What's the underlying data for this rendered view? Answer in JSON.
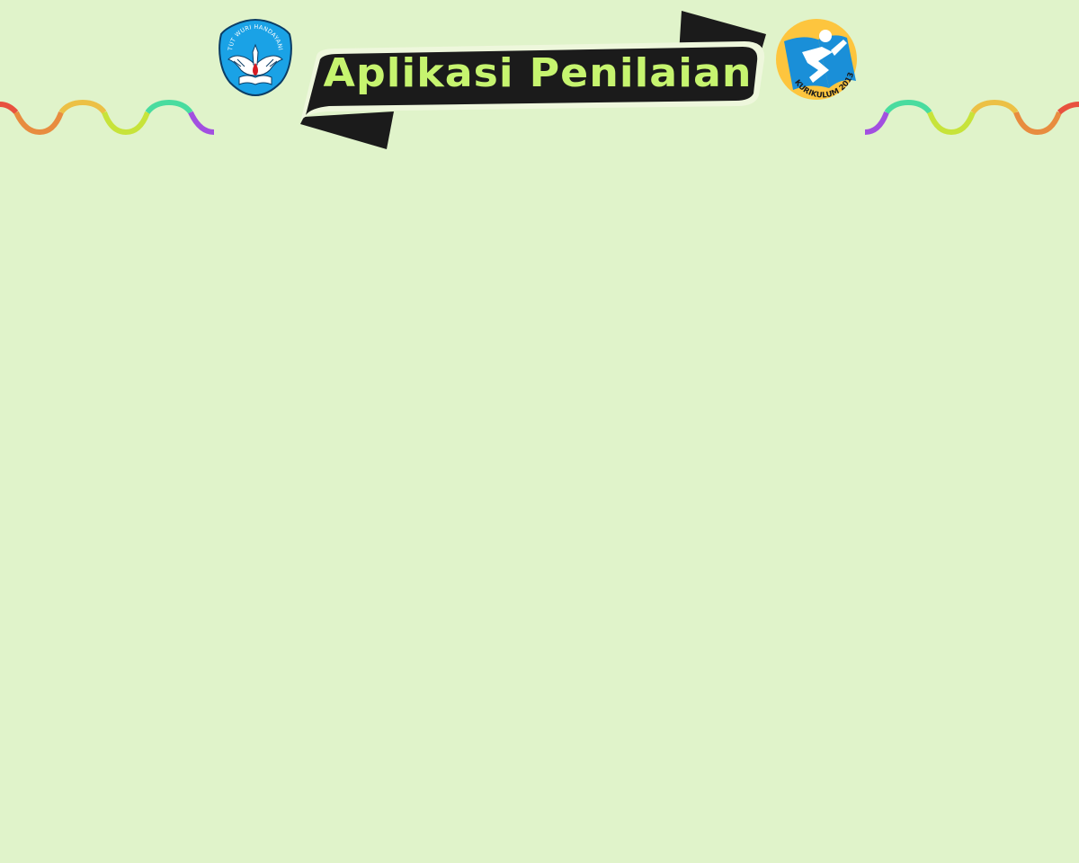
{
  "header": {
    "title": "Aplikasi Penilaian",
    "left_logo": {
      "icon": "tut-wuri-handayani-emblem-icon",
      "text": "TUT WURI HANDAYANI"
    },
    "right_logo": {
      "icon": "kurikulum-2013-logo-icon",
      "text": "KURIKULUM 2013"
    }
  },
  "colors": {
    "background": "#e0f3ca",
    "banner": "#1b1b1b",
    "banner_text": "#c6f46f",
    "wave_red": "#e8513f",
    "wave_orange": "#e88c3f",
    "wave_yellow": "#ecc045",
    "wave_lime": "#c7e33a",
    "wave_teal": "#49dc9f",
    "wave_purple": "#a24fe0",
    "emblem_blue": "#1aa2e6",
    "k13_yellow": "#fdc53e",
    "k13_blue": "#1a8fd8"
  },
  "main": {}
}
